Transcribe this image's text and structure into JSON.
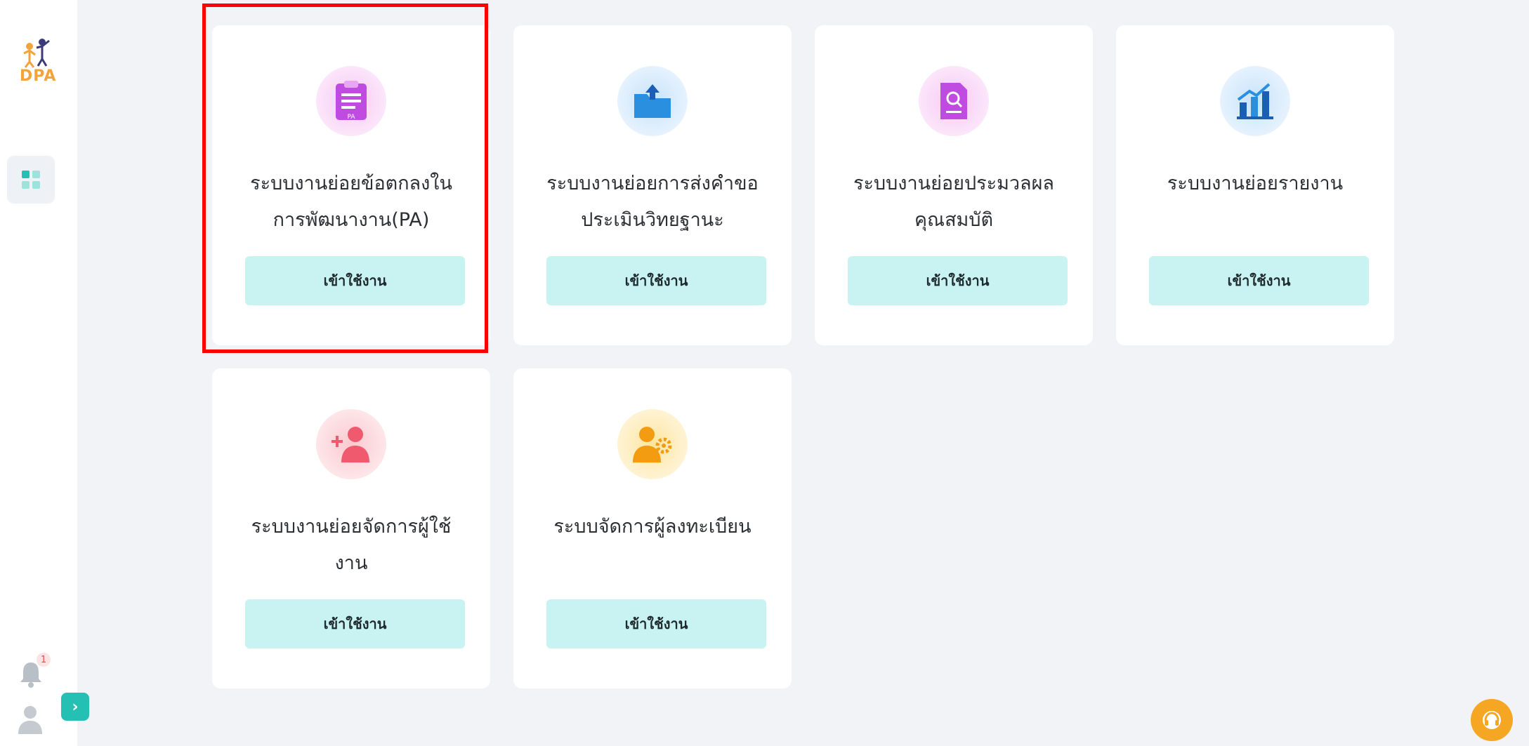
{
  "sidebar": {
    "logo_text": "DPA",
    "notification_count": "1"
  },
  "cards": [
    {
      "title_line1": "ระบบงานย่อยข้อตกลงใน",
      "title_line2": "การพัฒนางาน(PA)",
      "icon_label": "PA",
      "button": "เข้าใช้งาน"
    },
    {
      "title_line1": "ระบบงานย่อยการส่งคำขอ",
      "title_line2": "ประเมินวิทยฐานะ",
      "button": "เข้าใช้งาน"
    },
    {
      "title_line1": "ระบบงานย่อยประมวลผล",
      "title_line2": "คุณสมบัติ",
      "button": "เข้าใช้งาน"
    },
    {
      "title_line1": "ระบบงานย่อยรายงาน",
      "title_line2": "",
      "button": "เข้าใช้งาน"
    },
    {
      "title_line1": "ระบบงานย่อยจัดการผู้ใช้",
      "title_line2": "งาน",
      "button": "เข้าใช้งาน"
    },
    {
      "title_line1": "ระบบจัดการผู้ลงทะเบียน",
      "title_line2": "",
      "button": "เข้าใช้งาน"
    }
  ],
  "colors": {
    "accent": "#23c0b3",
    "button_bg": "#c9f3f2",
    "highlight": "#ff0000",
    "help": "#f5a623"
  },
  "icons": {
    "card1": "clipboard-icon",
    "card2": "upload-folder-icon",
    "card3": "document-search-icon",
    "card4": "bar-chart-icon",
    "card5": "add-user-icon",
    "card6": "user-settings-icon"
  }
}
